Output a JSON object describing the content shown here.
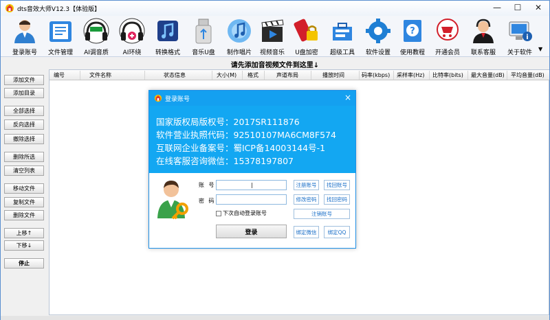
{
  "window": {
    "title": "dts音效大师V12.3【体验版】",
    "controls": {
      "minimize": "—",
      "maximize": "☐",
      "close": "✕"
    }
  },
  "toolbar": {
    "items": [
      {
        "label": "登录账号",
        "icon": "user-login-icon"
      },
      {
        "label": "文件管理",
        "icon": "file-manager-icon"
      },
      {
        "label": "AI调音质",
        "icon": "stereo-headphones-icon"
      },
      {
        "label": "AI环绕",
        "icon": "surround-headphones-icon"
      },
      {
        "label": "转换格式",
        "icon": "music-note-icon"
      },
      {
        "label": "音乐U盘",
        "icon": "usb-drive-icon"
      },
      {
        "label": "制作唱片",
        "icon": "music-disc-icon"
      },
      {
        "label": "视频音乐",
        "icon": "video-clapper-icon"
      },
      {
        "label": "U盘加密",
        "icon": "usb-lock-icon"
      },
      {
        "label": "超级工具",
        "icon": "toolbox-icon"
      },
      {
        "label": "软件设置",
        "icon": "gear-icon"
      },
      {
        "label": "使用教程",
        "icon": "help-book-icon"
      },
      {
        "label": "开通会员",
        "icon": "shopping-cart-icon"
      },
      {
        "label": "联系客服",
        "icon": "customer-service-icon"
      },
      {
        "label": "关于软件",
        "icon": "about-computer-icon"
      }
    ],
    "more": "▼"
  },
  "banner": {
    "text": "请先添加音视频文件到这里↓"
  },
  "sidebar": {
    "buttons": [
      "添加文件",
      "添加目录",
      "全部选择",
      "反向选择",
      "撤除选择",
      "删除所选",
      "清空列表",
      "移动文件",
      "复制文件",
      "删除文件",
      "上移↑",
      "下移↓",
      "停止"
    ]
  },
  "table": {
    "columns": [
      "编号",
      "文件名称",
      "状态信息",
      "大小(M)",
      "格式",
      "声道布局",
      "播放时间",
      "码率(kbps)",
      "采样率(Hz)",
      "比特率(bits)",
      "最大音量(dB)",
      "平均音量(dB)"
    ]
  },
  "dialog": {
    "title": "登录账号",
    "close": "×",
    "info_lines": [
      "国家版权局版权号：2017SR111876",
      "软件营业执照代码：92510107MA6CM8F574",
      "互联网企业备案号：蜀ICP备14003144号-1",
      "在线客服咨询微信：15378197807"
    ],
    "account_label": "账 号",
    "password_label": "密 码",
    "account_value": "|",
    "password_value": "",
    "remember_label": "下次自动登录账号",
    "login_button": "登录",
    "links": {
      "register": "注册账号",
      "find_account": "找回账号",
      "change_password": "修改密码",
      "find_password": "找回密码",
      "cancel_account": "注销账号",
      "bind_wechat": "绑定微信",
      "bind_qq": "绑定QQ"
    }
  }
}
